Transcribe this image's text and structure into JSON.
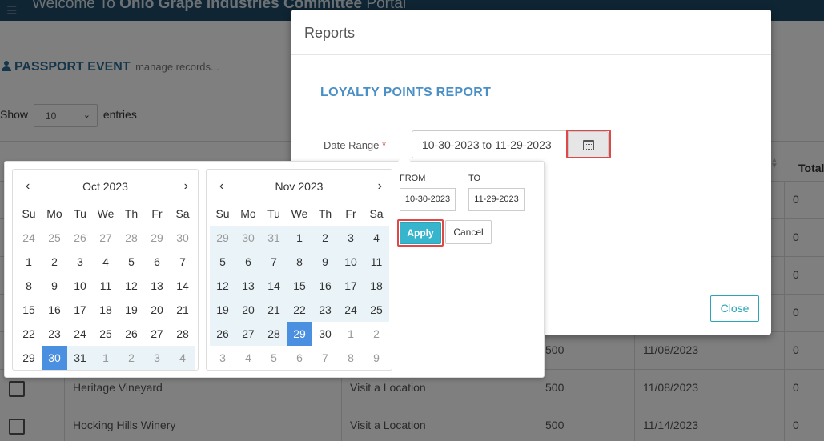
{
  "app": {
    "welcome_prefix": "Welcome To ",
    "welcome_org": "Ohio Grape Industries Committee",
    "welcome_suffix": " Portal"
  },
  "page": {
    "title": "PASSPORT EVENT",
    "subtitle": "manage records...",
    "show_label": "Show",
    "entries_value": "10",
    "entries_label": "entries",
    "total_header": "Total",
    "rows": [
      {
        "name": "",
        "activity": "",
        "points": "",
        "date": "",
        "total": "0"
      },
      {
        "name": "",
        "activity": "",
        "points": "",
        "date": "",
        "total": "0"
      },
      {
        "name": "",
        "activity": "",
        "points": "",
        "date": "",
        "total": "0"
      },
      {
        "name": "",
        "activity": "",
        "points": "",
        "date": "",
        "total": "0"
      },
      {
        "name": "",
        "activity": "",
        "points": "500",
        "date": "11/08/2023",
        "total": "0"
      },
      {
        "name": "Heritage Vineyard",
        "activity": "Visit a Location",
        "points": "500",
        "date": "11/08/2023",
        "total": "0"
      },
      {
        "name": "Hocking Hills Winery",
        "activity": "Visit a Location",
        "points": "500",
        "date": "11/14/2023",
        "total": "0"
      }
    ]
  },
  "modal": {
    "title": "Reports",
    "report_title": "LOYALTY POINTS REPORT",
    "date_range_label": "Date Range",
    "required_mark": "*",
    "date_range_value": "10-30-2023 to 11-29-2023",
    "close_label": "Close"
  },
  "picker": {
    "dow": [
      "Su",
      "Mo",
      "Tu",
      "We",
      "Th",
      "Fr",
      "Sa"
    ],
    "left": {
      "month": "Oct 2023",
      "prev": "‹",
      "next": "›",
      "weeks": [
        [
          "24",
          "25",
          "26",
          "27",
          "28",
          "29",
          "30"
        ],
        [
          "1",
          "2",
          "3",
          "4",
          "5",
          "6",
          "7"
        ],
        [
          "8",
          "9",
          "10",
          "11",
          "12",
          "13",
          "14"
        ],
        [
          "15",
          "16",
          "17",
          "18",
          "19",
          "20",
          "21"
        ],
        [
          "22",
          "23",
          "24",
          "25",
          "26",
          "27",
          "28"
        ],
        [
          "29",
          "30",
          "31",
          "1",
          "2",
          "3",
          "4"
        ]
      ]
    },
    "right": {
      "month": "Nov 2023",
      "prev": "‹",
      "next": "›",
      "weeks": [
        [
          "29",
          "30",
          "31",
          "1",
          "2",
          "3",
          "4"
        ],
        [
          "5",
          "6",
          "7",
          "8",
          "9",
          "10",
          "11"
        ],
        [
          "12",
          "13",
          "14",
          "15",
          "16",
          "17",
          "18"
        ],
        [
          "19",
          "20",
          "21",
          "22",
          "23",
          "24",
          "25"
        ],
        [
          "26",
          "27",
          "28",
          "29",
          "30",
          "1",
          "2"
        ],
        [
          "3",
          "4",
          "5",
          "6",
          "7",
          "8",
          "9"
        ]
      ]
    },
    "from_label": "FROM",
    "to_label": "TO",
    "from_value": "10-30-2023",
    "to_value": "11-29-2023",
    "apply_label": "Apply",
    "cancel_label": "Cancel"
  },
  "colors": {
    "accent": "#4a8fe0",
    "range_bg": "#e9f3f8",
    "apply": "#36b5cc",
    "highlight": "#e04848"
  }
}
